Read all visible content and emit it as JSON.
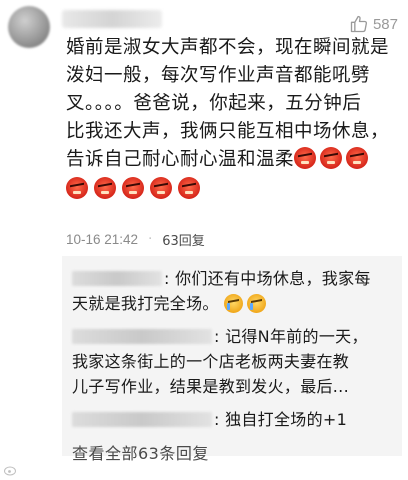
{
  "comment": {
    "like_count": "587",
    "body_lines": [
      "婚前是淑女大声都不会，现在瞬间就是",
      "泼妇一般，每次写作业声音都能吼劈",
      "叉。。。。爸爸说，你起来，五分钟后",
      "比我还大声，我俩只能互相中场休息，",
      "告诉自己耐心耐心温和温柔"
    ],
    "emoji_name": "angry-face-emoji",
    "timestamp": "10-16 21:42",
    "separator": "·",
    "reply_label": "63回复"
  },
  "replies": [
    {
      "lines": [
        ": 你们还有中场休息，我家每",
        "天就是我打完全场。"
      ],
      "emoji_name": "crying-face-emoji"
    },
    {
      "lines": ": 记得N年前的一天，",
      "line2": "我家这条街上的一个店老板两夫妻在教",
      "line3": "儿子写作业，结果是教到发火，最后..."
    },
    {
      "lines": ": 独自打全场的+1"
    }
  ],
  "view_all_label": "查看全部63条回复",
  "colors": {
    "meta_gray": "#8a8a8a",
    "reply_bg": "#f4f4f4",
    "like_gray": "#9a9a9a"
  }
}
